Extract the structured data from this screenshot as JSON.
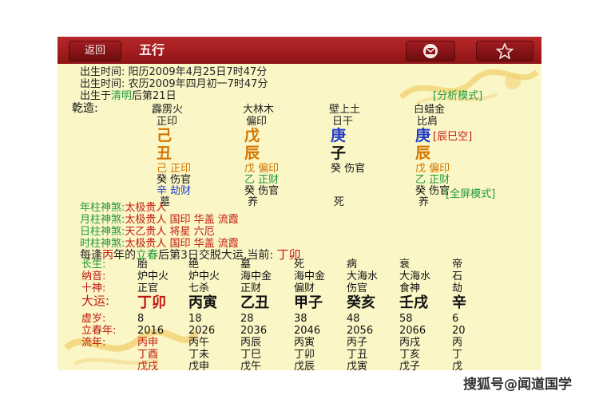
{
  "titlebar": {
    "back": "返回",
    "title": "五行",
    "mail_icon": "mail-icon",
    "star_icon": "star-icon"
  },
  "info": {
    "l1_label": "出生时间:",
    "l1_value": "阳历2009年4月25日7时47分",
    "l2_label": "出生时间:",
    "l2_value": "农历2009年四月初一7时47分",
    "l3_a": "出生于",
    "l3_b": "清明",
    "l3_c": "后第21日",
    "analyze": "[分析模式]"
  },
  "chart": {
    "label": "乾造:",
    "nayin": [
      "霹雳火",
      "大林木",
      "壁上土",
      "白蜡金"
    ],
    "shishen": [
      "正印",
      "偏印",
      "日干",
      "比肩"
    ],
    "gan": [
      "己",
      "戊",
      "庚",
      "庚"
    ],
    "zhi": [
      "丑",
      "辰",
      "子",
      "辰"
    ],
    "kongwang": "[辰巳空]",
    "cang1": [
      "己 正印",
      "戊 偏印",
      "癸 伤官",
      "戊 偏印"
    ],
    "cang2": [
      "癸 伤官",
      "乙 正财",
      "乙 正财"
    ],
    "cang3": [
      "辛 劫财",
      "癸 伤官",
      "癸 伤官"
    ],
    "state": [
      "墓",
      "养",
      "死",
      "养"
    ],
    "fullscreen": "[全屏模式]"
  },
  "shensha": [
    {
      "label": "年柱神煞:",
      "value": "太极贵人"
    },
    {
      "label": "月柱神煞:",
      "value": "太极贵人 国印 华盖 流霞"
    },
    {
      "label": "日柱神煞:",
      "value": "天乙贵人 将星 六厄"
    },
    {
      "label": "时柱神煞:",
      "value": "太极贵人 国印 华盖 流霞"
    }
  ],
  "yun": {
    "a": "每逢",
    "b": "丙",
    "c": "年的",
    "d": "立春",
    "e": "后第3日交脱大运,当前:",
    "f": "丁卯"
  },
  "table": {
    "h_changsheng": "长生:",
    "changsheng": [
      "胎",
      "绝",
      "墓",
      "死",
      "病",
      "衰",
      "帝"
    ],
    "h_nayin": "纳音:",
    "nayin": [
      "炉中火",
      "炉中火",
      "海中金",
      "海中金",
      "大海水",
      "大海水",
      "石"
    ],
    "h_shishen": "十神:",
    "shishen": [
      "正官",
      "七杀",
      "正财",
      "偏财",
      "伤官",
      "食神",
      "劫"
    ],
    "h_dayun": "大运:",
    "dayun": [
      "丁卯",
      "丙寅",
      "乙丑",
      "甲子",
      "癸亥",
      "壬戌",
      "辛"
    ],
    "h_xusui": "虚岁:",
    "xusui": [
      "8",
      "18",
      "28",
      "38",
      "48",
      "58",
      "6"
    ],
    "h_lichun": "立春年:",
    "lichun": [
      "2016",
      "2026",
      "2036",
      "2046",
      "2056",
      "2066",
      "20"
    ],
    "h_liunian": "流年:",
    "liunian": [
      "丙申",
      "丙午",
      "丙辰",
      "丙寅",
      "丙子",
      "丙戌",
      "丙"
    ],
    "liunian2": [
      "丁酉",
      "丁未",
      "丁巳",
      "丁卯",
      "丁丑",
      "丁亥",
      "丁"
    ],
    "liunian3": [
      "戊戌",
      "戊申",
      "戊午",
      "戊辰",
      "戊寅",
      "戊子",
      "戊"
    ]
  },
  "watermark": "搜狐号@闻道国学"
}
